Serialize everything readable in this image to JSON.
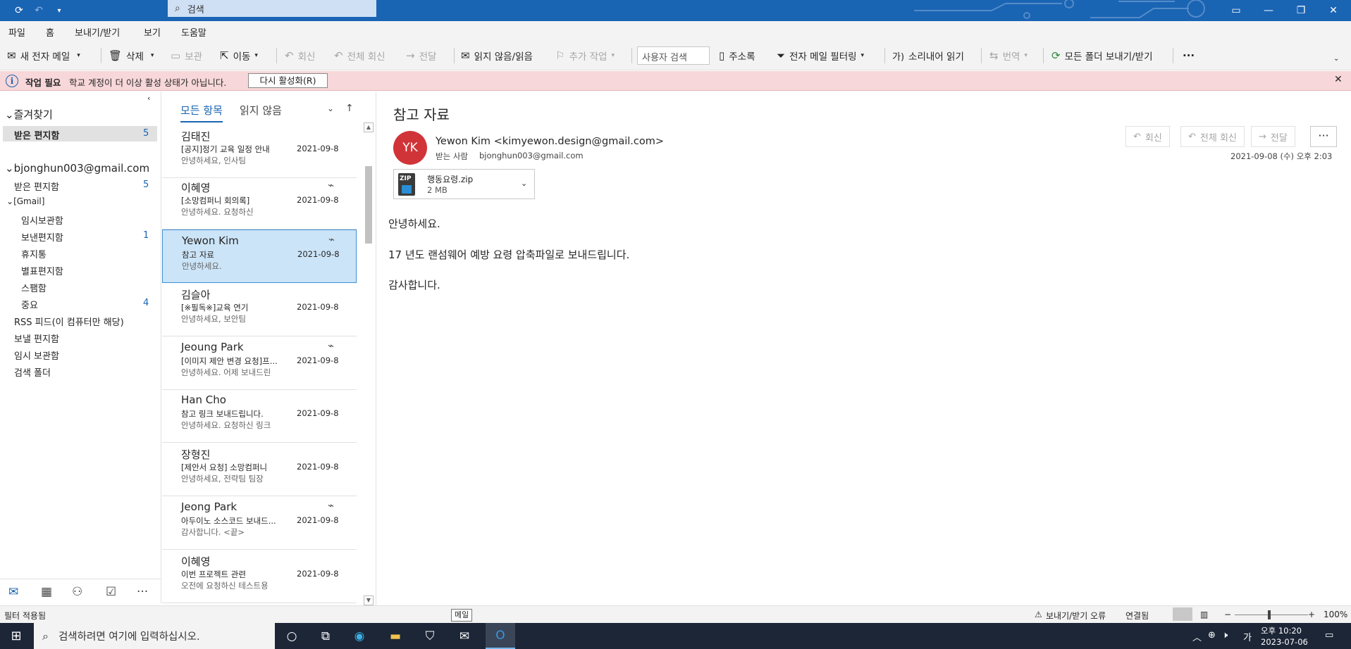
{
  "titlebar": {
    "search_placeholder": "검색"
  },
  "menu": {
    "file": "파일",
    "home": "홈",
    "send_receive": "보내기/받기",
    "view": "보기",
    "help": "도움말"
  },
  "toolbar": {
    "new_email": "새 전자 메일",
    "delete": "삭제",
    "archive": "보관",
    "move": "이동",
    "reply": "회신",
    "reply_all": "전체 회신",
    "forward": "전달",
    "read_unread": "읽지 않음/읽음",
    "followup": "추가 작업",
    "people_search": "사용자 검색",
    "address_book": "주소록",
    "filter_email": "전자 메일 필터링",
    "read_aloud": "소리내어 읽기",
    "translate": "번역",
    "send_receive_all": "모든 폴더 보내기/받기",
    "more": "···"
  },
  "infobar": {
    "title": "작업 필요",
    "message": "학교 계정이 더 이상 활성 상태가 아닙니다.",
    "button": "다시 활성화(R)"
  },
  "nav": {
    "favorites": "즐겨찾기",
    "fav_inbox": "받은 편지함",
    "fav_inbox_count": "5",
    "account": "bjonghun003@gmail.com",
    "inbox": "받은 편지함",
    "inbox_count": "5",
    "gmail": "[Gmail]",
    "drafts": "임시보관함",
    "sent": "보낸편지함",
    "sent_count": "1",
    "trash": "휴지통",
    "starred": "별표편지함",
    "spam": "스팸함",
    "important": "중요",
    "important_count": "4",
    "rss": "RSS 피드(이 컴퓨터만 해당)",
    "outbox": "보낼 편지함",
    "drafts2": "임시 보관함",
    "search_folders": "검색 폴더"
  },
  "list": {
    "tab_all": "모든 항목",
    "tab_unread": "읽지 않음",
    "messages": [
      {
        "sender": "김태진",
        "subject": "[공지]정기 교육 일정 안내",
        "preview": "안녕하세요, 인사팀",
        "date": "2021-09-8",
        "attachment": false
      },
      {
        "sender": "이혜영",
        "subject": "[소망컴퍼니 회의록]",
        "preview": "안녕하세요.  요청하신",
        "date": "2021-09-8",
        "attachment": true
      },
      {
        "sender": "Yewon Kim",
        "subject": "참고 자료",
        "preview": "안녕하세요.",
        "date": "2021-09-8",
        "attachment": true
      },
      {
        "sender": "김슬아",
        "subject": "[※필독※]교육 연기",
        "preview": "안녕하세요, 보안팀",
        "date": "2021-09-8",
        "attachment": false
      },
      {
        "sender": "Jeoung Park",
        "subject": "[이미지 제안 변경 요청]프...",
        "preview": "안녕하세요.  어제 보내드린",
        "date": "2021-09-8",
        "attachment": true
      },
      {
        "sender": "Han Cho",
        "subject": "참고 링크 보내드립니다.",
        "preview": "안녕하세요.  요청하신 링크",
        "date": "2021-09-8",
        "attachment": false
      },
      {
        "sender": "장형진",
        "subject": "[제안서 요청] 소망컴퍼니",
        "preview": "안녕하세요, 전략팀 팀장",
        "date": "2021-09-8",
        "attachment": false
      },
      {
        "sender": "Jeong Park",
        "subject": "아두이노 소스코드 보내드...",
        "preview": "감사합니다. <끝>",
        "date": "2021-09-8",
        "attachment": true
      },
      {
        "sender": "이혜영",
        "subject": "이번 프로젝트 관련",
        "preview": "오전에 요청하신 테스트용",
        "date": "2021-09-8",
        "attachment": false
      }
    ]
  },
  "reading": {
    "subject": "참고 자료",
    "avatar_initials": "YK",
    "from": "Yewon Kim <kimyewon.design@gmail.com>",
    "to_label": "받는 사람",
    "to": "bjonghun003@gmail.com",
    "datetime": "2021-09-08 (수) 오후 2:03",
    "reply": "회신",
    "reply_all": "전체 회신",
    "forward": "전달",
    "attachment_name": "행동요령.zip",
    "attachment_size": "2 MB",
    "body_greeting": "안녕하세요.",
    "body_main": "17 년도 랜섬웨어 예방 요령 압축파일로 보내드립니다.",
    "body_thanks": "감사합니다."
  },
  "status": {
    "filter": "필터 적용됨",
    "tooltip": "메일",
    "send_error": "보내기/받기 오류",
    "connected": "연결됨",
    "zoom": "100%"
  },
  "taskbar": {
    "search_placeholder": "검색하려면 여기에 입력하십시오.",
    "lang": "가",
    "time": "오후 10:20",
    "date": "2023-07-06"
  }
}
